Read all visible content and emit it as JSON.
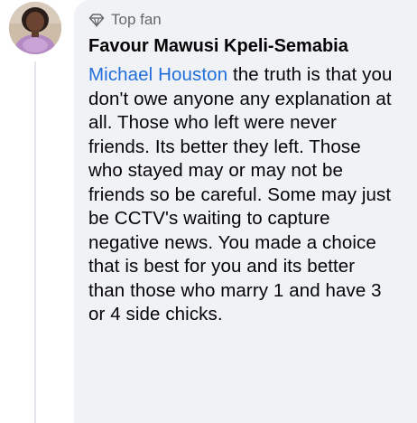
{
  "comment": {
    "badge_label": "Top fan",
    "badge_icon": "diamond-icon",
    "author": "Favour Mawusi Kpeli-Semabia",
    "mention": "Michael Houston",
    "body": " the truth is that you don't owe anyone any explanation at all. Those who left were never friends. Its better they left. Those who stayed may or may not be friends so be careful. Some may just be CCTV's waiting to capture negative news. You made a choice that is best for you and its better than those who marry 1 and have 3 or 4 side chicks."
  },
  "colors": {
    "bubble_background": "#f0f2f5",
    "mention_link": "#216fdb",
    "badge_text": "#65676b",
    "body_text": "#050505"
  }
}
